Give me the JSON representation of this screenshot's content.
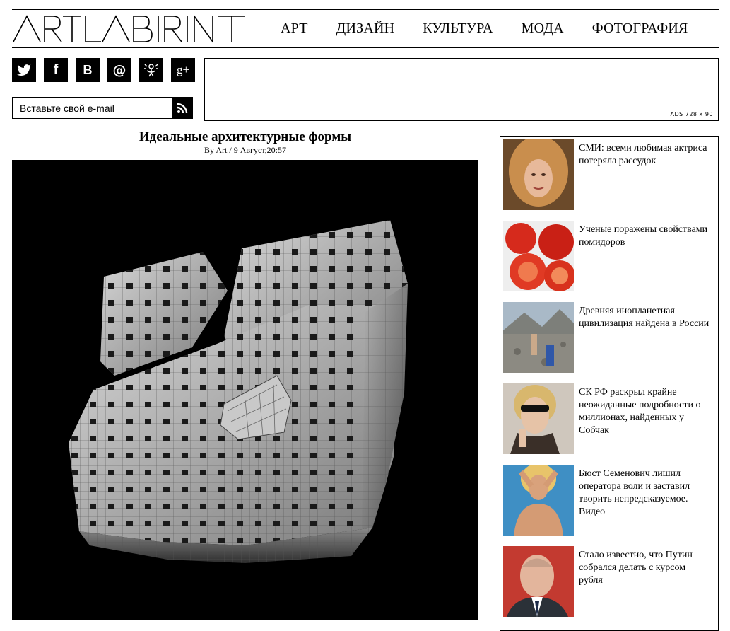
{
  "site": {
    "logo_text": "ARTLABIRINT"
  },
  "nav": {
    "items": [
      "АРТ",
      "ДИЗАЙН",
      "КУЛЬТУРА",
      "МОДА",
      "ФОТОГРАФИЯ"
    ]
  },
  "social": {
    "icons": [
      "twitter-icon",
      "facebook-icon",
      "vkontakte-icon",
      "mail-icon",
      "odnoklassniki-icon",
      "google-plus-icon"
    ]
  },
  "subscribe": {
    "placeholder": "Вставьте свой e-mail"
  },
  "ad": {
    "label": "ADS 728 x 90"
  },
  "article": {
    "title": "Идеальные архитектурные формы",
    "meta": "By Art / 9 Август,20:57"
  },
  "sidebar": {
    "items": [
      {
        "title": "СМИ: всеми любимая актриса потеряла рассудок"
      },
      {
        "title": "Ученые поражены свойствами помидоров"
      },
      {
        "title": "Древняя инопланетная цивилизация найдена в России"
      },
      {
        "title": "СК РФ раскрыл крайне неожиданные подробности о миллионах, найденных у Собчак"
      },
      {
        "title": "Бюст Семенович лишил оператора воли и заставил творить непредсказуемое. Видео"
      },
      {
        "title": "Стало известно, что Путин собрался делать с курсом рубля"
      }
    ]
  },
  "colors": {
    "text": "#000000",
    "background": "#ffffff"
  }
}
